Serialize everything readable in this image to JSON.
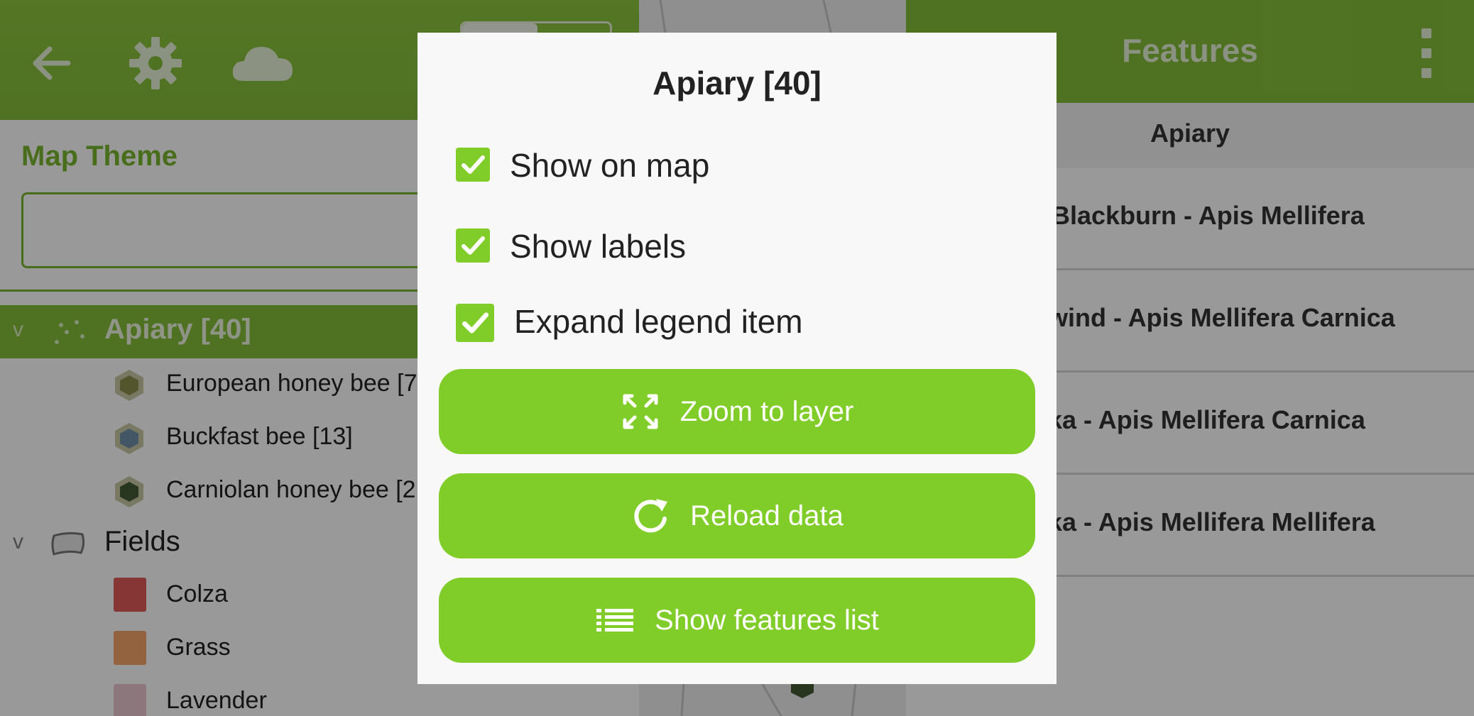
{
  "colors": {
    "accent": "#80cc28",
    "header_green": "#84be3a",
    "theme_text": "#79b82f"
  },
  "drawer": {
    "header_icons": [
      "back-arrow-icon",
      "gear-icon",
      "cloud-icon"
    ],
    "map_theme_title": "Map Theme",
    "map_theme_value": "",
    "apiary_layer": {
      "label": "Apiary [40]",
      "expanded": true
    },
    "apiary_legend": [
      {
        "label": "European honey bee [7",
        "color": "#8b8f4a"
      },
      {
        "label": "Buckfast bee [13]",
        "color": "#6f8fa8"
      },
      {
        "label": "Carniolan honey bee [2",
        "color": "#445a36"
      }
    ],
    "fields_layer": {
      "label": "Fields",
      "expanded": true
    },
    "fields_legend": [
      {
        "label": "Colza",
        "color": "#e25b5b"
      },
      {
        "label": "Grass",
        "color": "#f5a46a"
      },
      {
        "label": "Lavender",
        "color": "#e8c7cf"
      }
    ]
  },
  "panel": {
    "title": "Features",
    "subtitle": "Apiary",
    "rows": [
      "Blackburn - Apis Mellifera",
      "wind - Apis Mellifera Carnica",
      "ka - Apis Mellifera Carnica",
      "ka - Apis Mellifera Mellifera"
    ]
  },
  "dialog": {
    "title": "Apiary [40]",
    "checks": [
      {
        "label": "Show on map",
        "checked": true
      },
      {
        "label": "Show labels",
        "checked": true
      },
      {
        "label": "Expand legend item",
        "checked": true
      }
    ],
    "buttons": {
      "zoom": {
        "label": "Zoom to layer",
        "icon": "zoom-to-extent-icon"
      },
      "reload": {
        "label": "Reload data",
        "icon": "refresh-icon"
      },
      "features": {
        "label": "Show features list",
        "icon": "list-icon"
      }
    }
  }
}
